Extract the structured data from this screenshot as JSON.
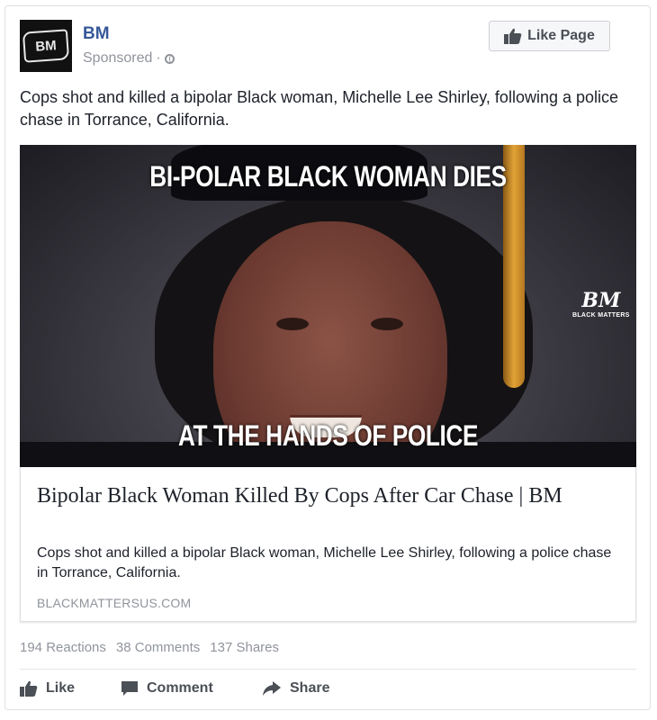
{
  "post": {
    "page_name": "BM",
    "avatar_text": "BM",
    "sponsored_label": "Sponsored",
    "sponsored_sep": "·",
    "like_page_label": "Like Page",
    "text": "Cops shot and killed a bipolar Black woman, Michelle Lee Shirley, following a police chase in Torrance, California."
  },
  "image": {
    "headline_top": "BI-POLAR BLACK WOMAN DIES",
    "headline_bottom": "AT THE HANDS OF POLICE",
    "watermark_logo": "BM",
    "watermark_text": "BLACK MATTERS"
  },
  "link": {
    "title": "Bipolar Black Woman Killed By Cops After Car Chase | BM",
    "description": "Cops shot and killed a bipolar Black woman, Michelle Lee Shirley, following a police chase in Torrance, California.",
    "domain": "BLACKMATTERSUS.COM"
  },
  "stats": {
    "reactions": "194 Reactions",
    "comments": "38 Comments",
    "shares": "137 Shares"
  },
  "actions": {
    "like": "Like",
    "comment": "Comment",
    "share": "Share"
  },
  "icons": [
    "globe-icon",
    "thumbs-up-icon",
    "comment-icon",
    "share-icon"
  ],
  "colors": {
    "page_name": "#365899",
    "muted": "#90949c",
    "text": "#1d2129"
  }
}
